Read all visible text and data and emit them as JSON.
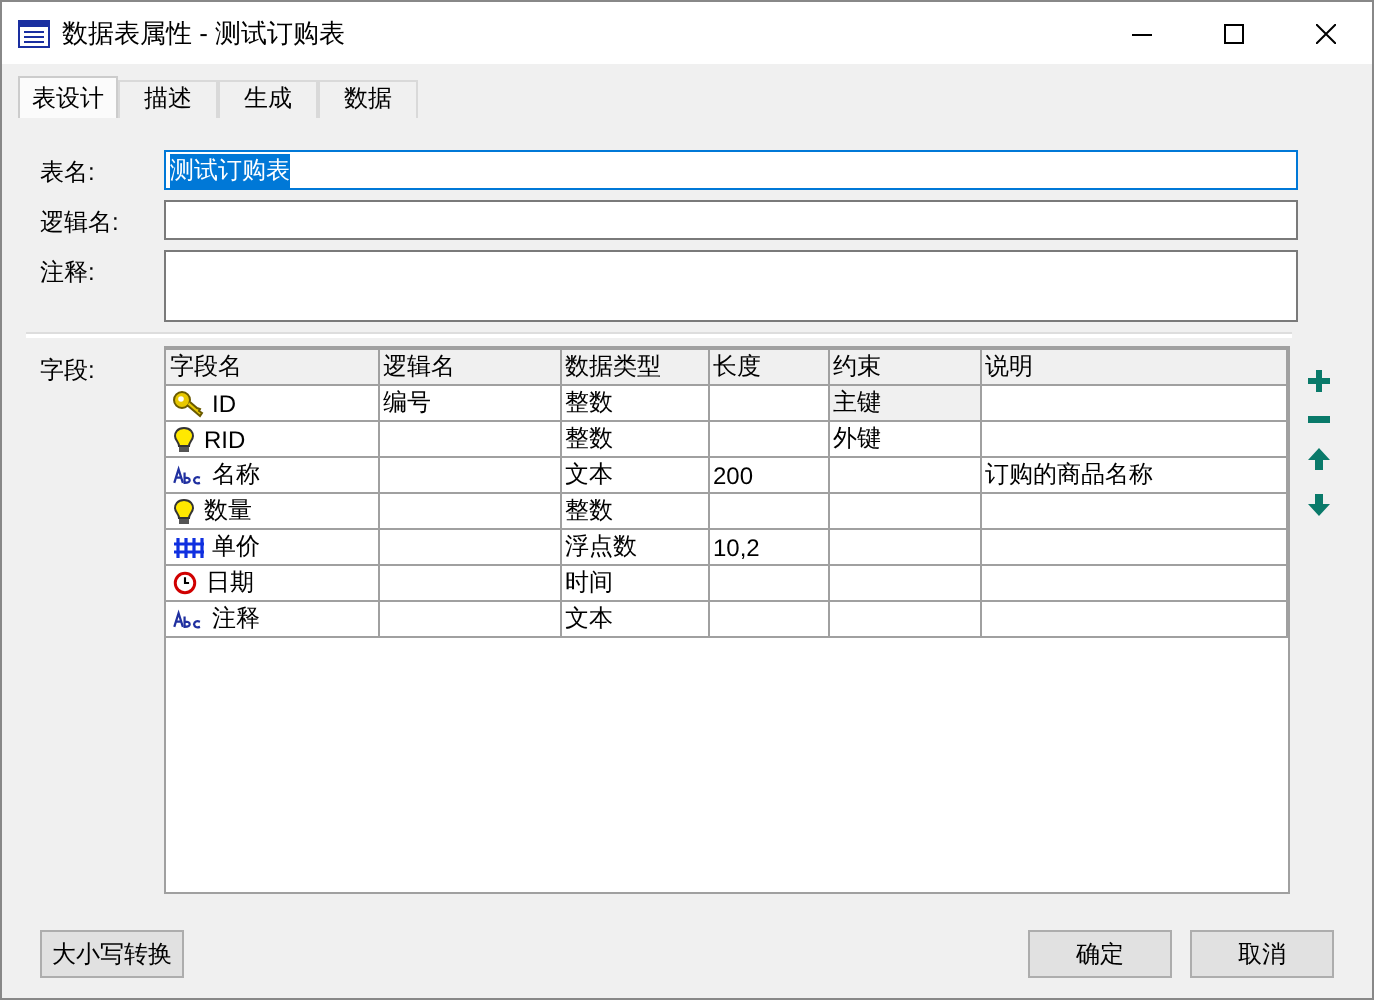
{
  "window": {
    "title": "数据表属性 - 测试订购表"
  },
  "tabs": [
    {
      "label": "表设计",
      "selected": true
    },
    {
      "label": "描述",
      "selected": false
    },
    {
      "label": "生成",
      "selected": false
    },
    {
      "label": "数据",
      "selected": false
    }
  ],
  "form": [
    {
      "label": "表名:",
      "value": "测试订购表",
      "focused": true,
      "kind": "line"
    },
    {
      "label": "逻辑名:",
      "focused": false,
      "kind": "line"
    },
    {
      "label": "注释:",
      "focused": false,
      "kind": "area"
    }
  ],
  "fields": {
    "label": "字段:",
    "columns": [
      "字段名",
      "逻辑名",
      "数据类型",
      "长度",
      "约束",
      "说明"
    ],
    "rows": [
      {
        "kind": "key",
        "cells": [
          "ID",
          "编号",
          "整数",
          "",
          "主键",
          ""
        ],
        "constraint_shaded": true
      },
      {
        "kind": "bulb",
        "cells": [
          "RID",
          "",
          "整数",
          "",
          "外键",
          ""
        ],
        "constraint_shaded": false
      },
      {
        "kind": "abc",
        "cells": [
          "名称",
          "",
          "文本",
          "200",
          "",
          "订购的商品名称"
        ],
        "constraint_shaded": false
      },
      {
        "kind": "bulb",
        "cells": [
          "数量",
          "",
          "整数",
          "",
          "",
          ""
        ],
        "constraint_shaded": false
      },
      {
        "kind": "hash",
        "cells": [
          "单价",
          "",
          "浮点数",
          "10,2",
          "",
          ""
        ],
        "constraint_shaded": false
      },
      {
        "kind": "clock",
        "cells": [
          "日期",
          "",
          "时间",
          "",
          "",
          ""
        ],
        "constraint_shaded": false
      },
      {
        "kind": "abc",
        "cells": [
          "注释",
          "",
          "文本",
          "",
          "",
          ""
        ],
        "constraint_shaded": false
      }
    ]
  },
  "buttons": {
    "left": [
      "大小写转换"
    ],
    "right": [
      "确定",
      "取消"
    ]
  }
}
